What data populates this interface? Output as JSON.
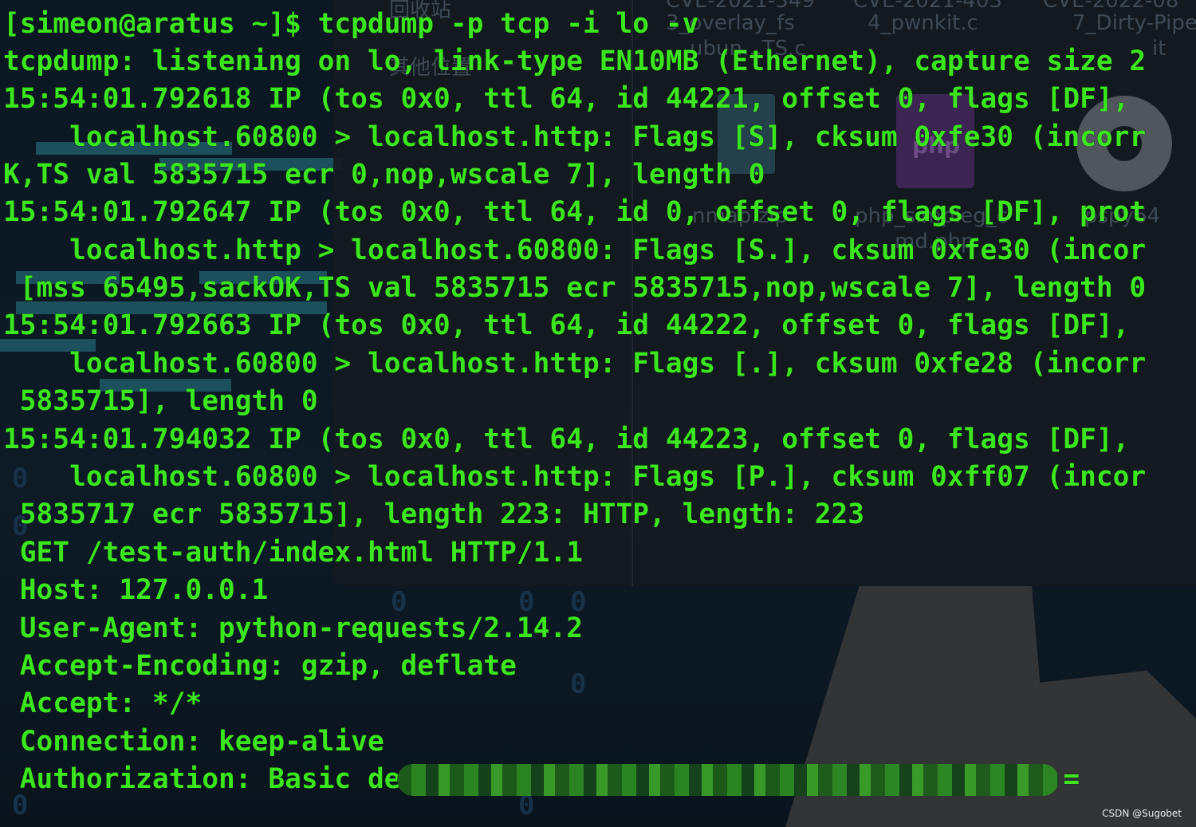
{
  "desktop": {
    "file_manager": {
      "trash_label": "回收站",
      "other_locations_label": "其他位置",
      "files": [
        "CVE-2021-349",
        "CVE-2021-403",
        "CVE-2022-08",
        "3_overlay_fs",
        "4_pwnkit.c",
        "7_Dirty-Pipe",
        "ubun...TS.c",
        "it",
        "nmap.zip",
        "php_simpleg_c",
        "md.php",
        "pspy64"
      ]
    }
  },
  "terminal": {
    "lines": [
      "[simeon@aratus ~]$ tcpdump -p tcp -i lo -v",
      "tcpdump: listening on lo, link-type EN10MB (Ethernet), capture size 2",
      "15:54:01.792618 IP (tos 0x0, ttl 64, id 44221, offset 0, flags [DF],",
      "    localhost.60800 > localhost.http: Flags [S], cksum 0xfe30 (incorr",
      "K,TS val 5835715 ecr 0,nop,wscale 7], length 0",
      "15:54:01.792647 IP (tos 0x0, ttl 64, id 0, offset 0, flags [DF], prot",
      "    localhost.http > localhost.60800: Flags [S.], cksum 0xfe30 (incor",
      " [mss 65495,sackOK,TS val 5835715 ecr 5835715,nop,wscale 7], length 0",
      "15:54:01.792663 IP (tos 0x0, ttl 64, id 44222, offset 0, flags [DF],",
      "    localhost.60800 > localhost.http: Flags [.], cksum 0xfe28 (incorr",
      " 5835715], length 0",
      "15:54:01.794032 IP (tos 0x0, ttl 64, id 44223, offset 0, flags [DF],",
      "    localhost.60800 > localhost.http: Flags [P.], cksum 0xff07 (incor",
      " 5835717 ecr 5835715], length 223: HTTP, length: 223",
      " GET /test-auth/index.html HTTP/1.1",
      " Host: 127.0.0.1",
      " User-Agent: python-requests/2.14.2",
      " Accept-Encoding: gzip, deflate",
      " Accept: */*",
      " Connection: keep-alive",
      " Authorization: Basic de                                        ="
    ],
    "text_color": "#3ce61e"
  },
  "watermark": "CSDN @Sugobet"
}
